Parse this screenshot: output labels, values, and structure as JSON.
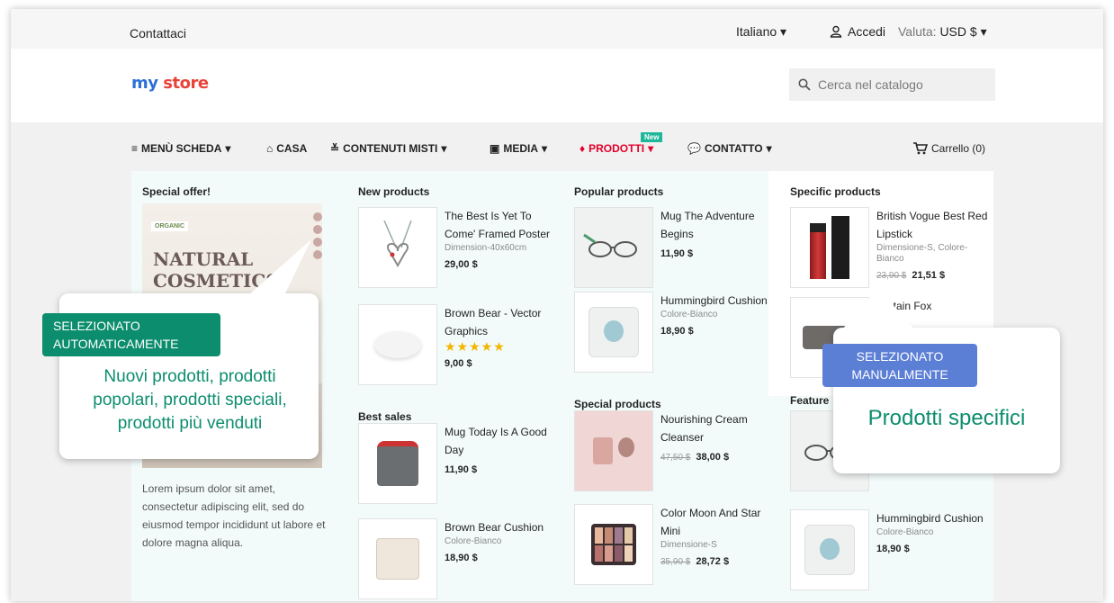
{
  "topbar": {
    "contact": "Contattaci",
    "language": "Italiano",
    "login": "Accedi",
    "currency_label": "Valuta:",
    "currency_value": "USD $"
  },
  "logo": {
    "part1": "my",
    "part2": "store"
  },
  "search": {
    "placeholder": "Cerca nel catalogo"
  },
  "nav": {
    "items": [
      "MENÙ SCHEDA",
      "CASA",
      "CONTENUTI MISTI",
      "MEDIA",
      "PRODOTTI",
      "CONTATTO"
    ],
    "new_badge": "New",
    "cart": "Carrello (0)"
  },
  "mega": {
    "special_offer": {
      "title": "Special offer!",
      "image_brand": "ORGANIC",
      "image_heading": "NATURAL COSMETICS",
      "text": "Lorem ipsum dolor sit amet, consectetur adipiscing elit, sed do eiusmod tempor incididunt ut labore et dolore magna aliqua."
    },
    "new_products": {
      "title": "New products",
      "items": [
        {
          "name": "The Best Is Yet To Come' Framed Poster",
          "variant": "Dimension-40x60cm",
          "price": "29,00 $"
        },
        {
          "name": "Brown Bear - Vector Graphics",
          "rating": "★★★★★",
          "price": "9,00 $"
        }
      ]
    },
    "best_sales": {
      "title": "Best sales",
      "items": [
        {
          "name": "Mug Today Is A Good Day",
          "price": "11,90 $"
        },
        {
          "name": "Brown Bear Cushion",
          "variant": "Colore-Bianco",
          "price": "18,90 $"
        }
      ]
    },
    "popular_products": {
      "title": "Popular products",
      "items": [
        {
          "name": "Mug The Adventure Begins",
          "price": "11,90 $"
        },
        {
          "name": "Hummingbird Cushion",
          "variant": "Colore-Bianco",
          "price": "18,90 $"
        }
      ]
    },
    "special_products": {
      "title": "Special products",
      "items": [
        {
          "name": "Nourishing Cream Cleanser",
          "old_price": "47,50 $",
          "price": "38,00 $"
        },
        {
          "name": "Color Moon And Star Mini",
          "variant": "Dimensione-S",
          "old_price": "35,90 $",
          "price": "28,72 $"
        }
      ]
    },
    "specific_products": {
      "title": "Specific products",
      "items": [
        {
          "name": "British Vogue Best Red Lipstick",
          "variant": "Dimensione-S, Colore-Bianco",
          "old_price": "23,90 $",
          "price": "21,51 $"
        },
        {
          "name": "…ntain Fox"
        }
      ]
    },
    "featured": {
      "title": "Feature",
      "items": [
        {
          "name": "Hummingbird Cushion",
          "variant": "Colore-Bianco",
          "price": "18,90 $"
        }
      ]
    }
  },
  "callouts": {
    "auto": {
      "tag": "SELEZIONATO AUTOMATICAMENTE",
      "text": "Nuovi prodotti, prodotti popolari, prodotti speciali, prodotti più venduti"
    },
    "manual": {
      "tag": "SELEZIONATO MANUALMENTE",
      "text": "Prodotti specifici"
    }
  },
  "colors": {
    "accent_green": "#0c8d6e",
    "accent_blue": "#5c7fd6",
    "nav_red": "#e4002b",
    "badge": "#1fb79a"
  }
}
